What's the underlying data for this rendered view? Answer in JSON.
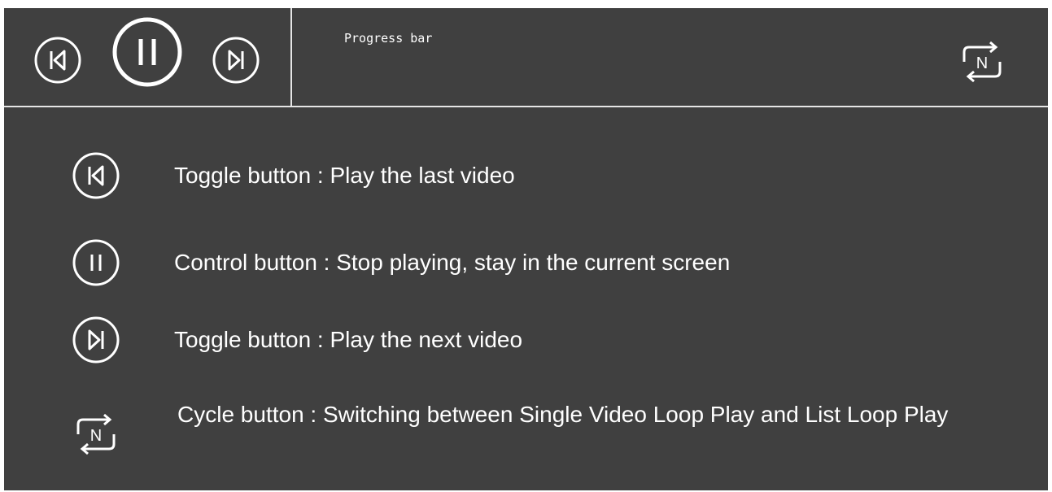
{
  "player": {
    "progress_label": "Progress bar",
    "icons": {
      "previous": "skip-previous-icon",
      "pause": "pause-icon",
      "next": "skip-next-icon",
      "cycle": "repeat-n-icon"
    },
    "cycle_letter": "N"
  },
  "legend": {
    "items": [
      {
        "icon": "skip-previous-icon",
        "text": "Toggle button : Play the last video"
      },
      {
        "icon": "pause-icon",
        "text": "Control button : Stop playing, stay in the current screen"
      },
      {
        "icon": "skip-next-icon",
        "text": "Toggle button : Play the next video"
      },
      {
        "icon": "repeat-n-icon",
        "text": "Cycle button : Switching between Single Video Loop Play and List Loop Play"
      }
    ]
  },
  "colors": {
    "background": "#404040",
    "foreground": "#ffffff",
    "divider": "#e6e6e6"
  }
}
